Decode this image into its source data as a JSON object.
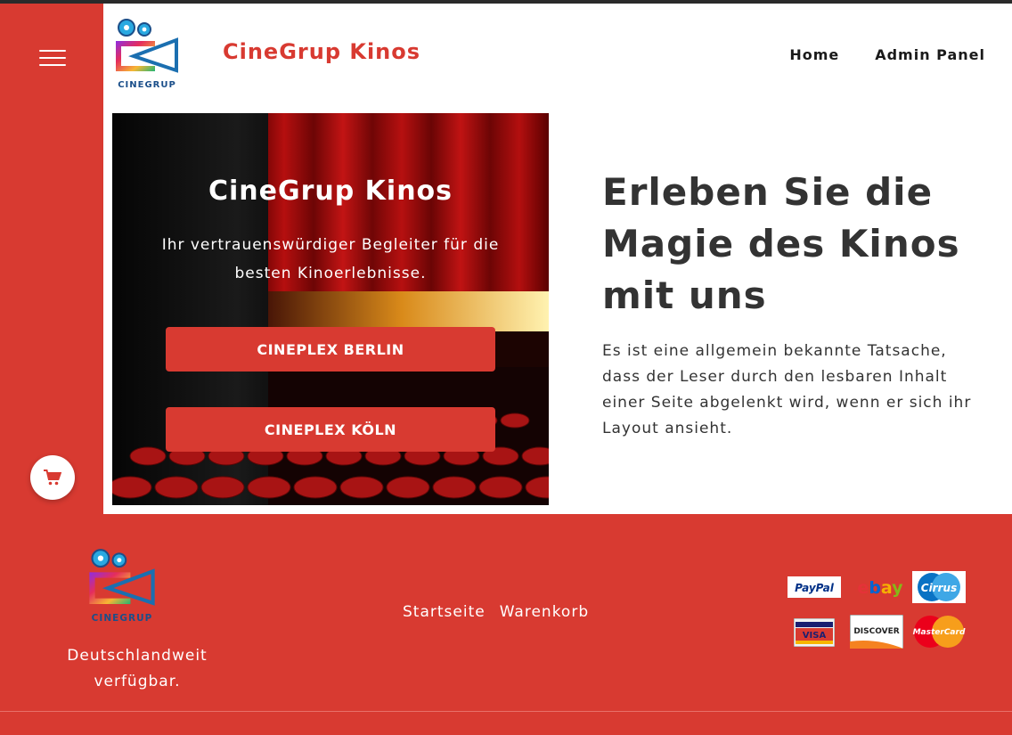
{
  "header": {
    "brand": "CineGrup Kinos",
    "logo_text": "CINEGRUP",
    "nav": [
      "Home",
      "Admin Panel"
    ]
  },
  "hero": {
    "title": "CineGrup Kinos",
    "subtitle": "Ihr vertrauenswürdiger Begleiter für die besten Kinoerlebnisse.",
    "buttons": [
      "CINEPLEX BERLIN",
      "CINEPLEX KÖLN"
    ]
  },
  "intro": {
    "headline": "Erleben Sie die Magie des Kinos mit uns",
    "text": "Es ist eine allgemein bekannte Tatsache, dass der Leser durch den lesbaren Inhalt einer Seite abgelenkt wird, wenn er sich ihr Layout ansieht."
  },
  "footer": {
    "logo_text": "CINEGRUP",
    "tagline": "Deutschlandweit verfügbar.",
    "links": [
      "Startseite",
      "Warenkorb"
    ],
    "payment_methods": [
      "PayPal",
      "ebay",
      "Cirrus",
      "VISA",
      "DISCOVER",
      "MasterCard"
    ]
  },
  "colors": {
    "brand_red": "#d83a31",
    "text_dark": "#333333"
  },
  "icons": {
    "menu": "hamburger-icon",
    "cart": "shopping-cart-icon"
  }
}
